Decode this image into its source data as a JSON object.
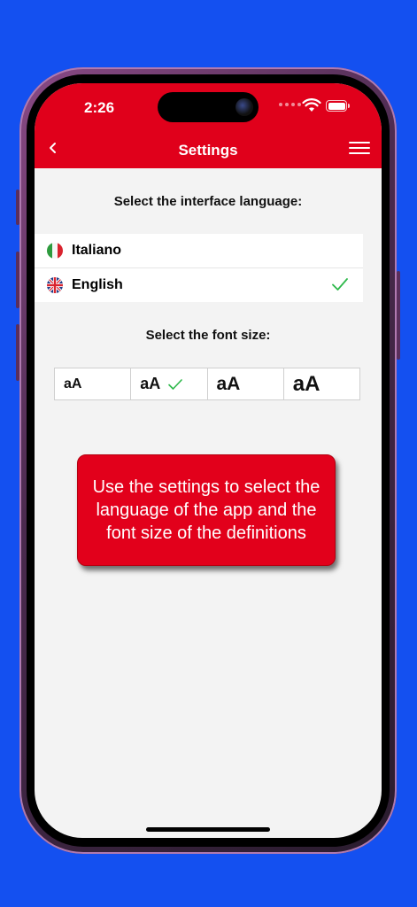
{
  "status_bar": {
    "time": "2:26"
  },
  "nav": {
    "title": "Settings"
  },
  "language_section": {
    "label": "Select the interface language:",
    "options": [
      {
        "name": "Italiano",
        "flag": "italy-flag-icon",
        "selected": false
      },
      {
        "name": "English",
        "flag": "uk-flag-icon",
        "selected": true
      }
    ]
  },
  "font_section": {
    "label": "Select the font size:",
    "sizes": [
      {
        "label": "aA",
        "selected": false
      },
      {
        "label": "aA",
        "selected": true
      },
      {
        "label": "aA",
        "selected": false
      },
      {
        "label": "aA",
        "selected": false
      }
    ]
  },
  "banner": {
    "text": "Use the settings to select the language of the app and the font size of the definitions"
  },
  "colors": {
    "accent": "#e0001b",
    "background": "#1450f0",
    "check": "#2db84a"
  }
}
